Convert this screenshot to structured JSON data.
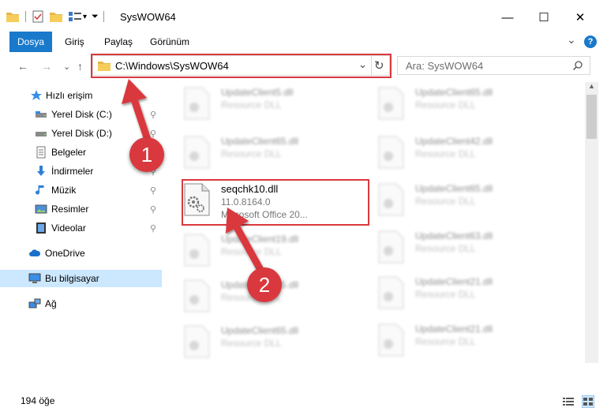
{
  "window": {
    "title": "SysWOW64",
    "minimize": "—",
    "maximize": "☐",
    "close": "✕"
  },
  "ribbon": {
    "tabs": [
      "Dosya",
      "Giriş",
      "Paylaş",
      "Görünüm"
    ],
    "expand": "⌄",
    "help": "?"
  },
  "nav": {
    "back": "←",
    "forward": "→",
    "recent": "⌄",
    "up": "↑",
    "address": "C:\\Windows\\SysWOW64",
    "address_dropdown": "⌄",
    "refresh": "↻",
    "search_placeholder": "Ara: SysWOW64"
  },
  "sidebar": {
    "items": [
      {
        "label": "Hızlı erişim",
        "icon": "star-icon"
      },
      {
        "label": "Yerel Disk (C:)",
        "icon": "drive-icon"
      },
      {
        "label": "Yerel Disk (D:)",
        "icon": "drive-icon"
      },
      {
        "label": "Belgeler",
        "icon": "documents-icon"
      },
      {
        "label": "İndirmeler",
        "icon": "download-icon"
      },
      {
        "label": "Müzik",
        "icon": "music-icon"
      },
      {
        "label": "Resimler",
        "icon": "pictures-icon"
      },
      {
        "label": "Videolar",
        "icon": "videos-icon"
      },
      {
        "label": "OneDrive",
        "icon": "cloud-icon"
      },
      {
        "label": "Bu bilgisayar",
        "icon": "computer-icon"
      },
      {
        "label": "Ağ",
        "icon": "network-icon"
      }
    ],
    "pin_glyph": "📌"
  },
  "files": {
    "left": [
      {
        "name": "UpdateClient5.dll",
        "type": "Resource DLL"
      },
      {
        "name": "UpdateClient65.dll",
        "type": "Resource DLL"
      },
      {
        "name": "seqchk10.dll",
        "version": "11.0.8164.0",
        "type": "Microsoft Office 20..."
      },
      {
        "name": "UpdateClient19.dll",
        "type": "Resource DLL"
      },
      {
        "name": "UpdateClient65.dll",
        "type": "Resource DLL"
      },
      {
        "name": "UpdateClient65.dll",
        "type": "Resource DLL"
      }
    ],
    "right": [
      {
        "name": "UpdateClient65.dll",
        "type": "Resource DLL"
      },
      {
        "name": "UpdateClient42.dll",
        "type": "Resource DLL"
      },
      {
        "name": "UpdateClient65.dll",
        "type": "Resource DLL"
      },
      {
        "name": "UpdateClient63.dll",
        "type": "Resource DLL"
      },
      {
        "name": "UpdateClient21.dll",
        "type": "Resource DLL"
      },
      {
        "name": "UpdateClient21.dll",
        "type": "Resource DLL"
      }
    ]
  },
  "annotations": {
    "step1": "1",
    "step2": "2"
  },
  "status": {
    "item_count": "194 öğe"
  },
  "colors": {
    "accent": "#1979ca",
    "highlight": "#d9393e",
    "selected": "#cce8ff"
  }
}
